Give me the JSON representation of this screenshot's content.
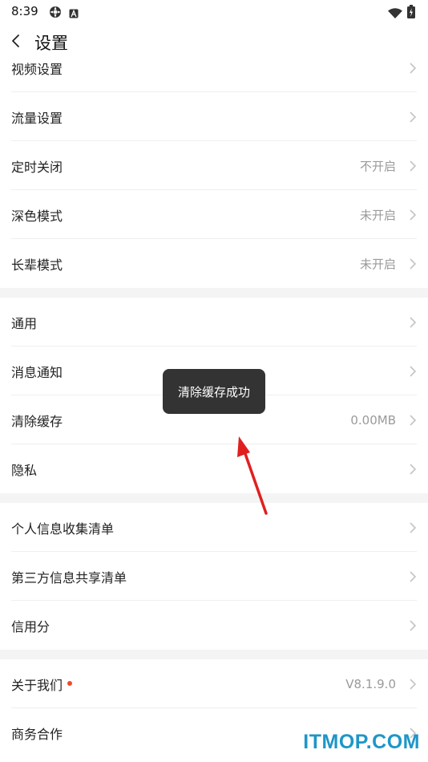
{
  "status_bar": {
    "time": "8:39",
    "icons": [
      "settings-like-icon",
      "a-letter-icon",
      "wifi-icon",
      "battery-icon"
    ]
  },
  "header": {
    "back_icon": "chevron-left-icon",
    "title": "设置"
  },
  "section1": [
    {
      "label": "视频设置",
      "value": ""
    },
    {
      "label": "流量设置",
      "value": ""
    },
    {
      "label": "定时关闭",
      "value": "不开启"
    },
    {
      "label": "深色模式",
      "value": "未开启"
    },
    {
      "label": "长辈模式",
      "value": "未开启"
    }
  ],
  "section2": [
    {
      "label": "通用",
      "value": ""
    },
    {
      "label": "消息通知",
      "value": ""
    },
    {
      "label": "清除缓存",
      "value": "0.00MB"
    },
    {
      "label": "隐私",
      "value": ""
    }
  ],
  "section3": [
    {
      "label": "个人信息收集清单",
      "value": ""
    },
    {
      "label": "第三方信息共享清单",
      "value": ""
    },
    {
      "label": "信用分",
      "value": ""
    }
  ],
  "section4": [
    {
      "label": "关于我们",
      "value": "V8.1.9.0",
      "has_red_dot": true
    },
    {
      "label": "商务合作",
      "value": ""
    }
  ],
  "toast": {
    "text": "清除缓存成功"
  },
  "watermark": {
    "text": "ITMOP.COM"
  },
  "colors": {
    "annotation_arrow": "#e02020",
    "red_dot": "#f04a2a",
    "toast_bg": "#333333",
    "watermark": "#1e96c8",
    "section_gap": "#f4f4f4"
  }
}
